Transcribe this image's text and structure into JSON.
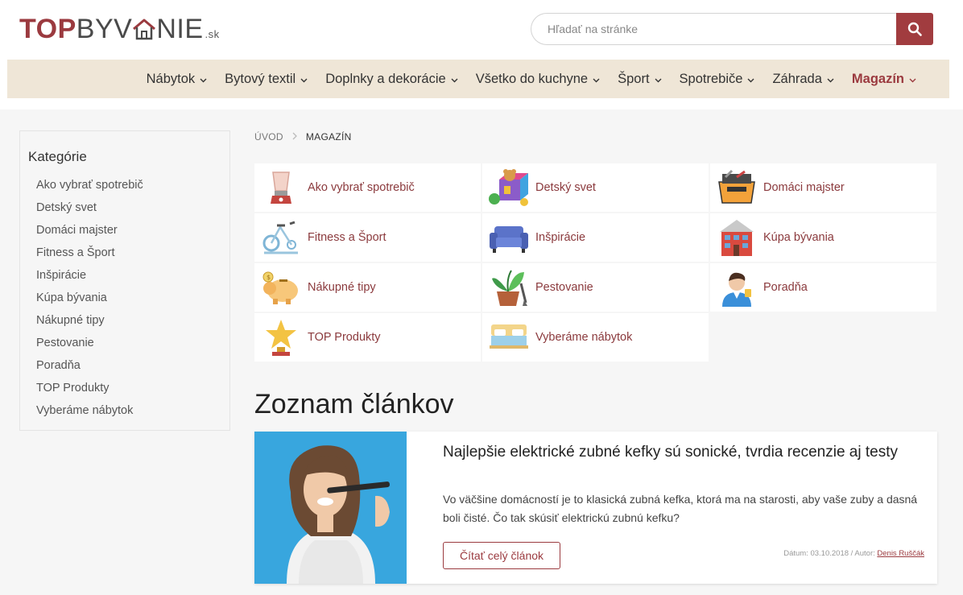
{
  "logo": {
    "part1": "TOP",
    "part2": "BYV",
    "part3": "NIE",
    "suffix": ".sk"
  },
  "search": {
    "placeholder": "Hľadať na stránke"
  },
  "nav": [
    {
      "label": "Nábytok",
      "active": false
    },
    {
      "label": "Bytový textil",
      "active": false
    },
    {
      "label": "Doplnky a dekorácie",
      "active": false
    },
    {
      "label": "Všetko do kuchyne",
      "active": false
    },
    {
      "label": "Šport",
      "active": false
    },
    {
      "label": "Spotrebiče",
      "active": false
    },
    {
      "label": "Záhrada",
      "active": false
    },
    {
      "label": "Magazín",
      "active": true
    }
  ],
  "sidebar": {
    "title": "Kategórie",
    "items": [
      "Ako vybrať spotrebič",
      "Detský svet",
      "Domáci majster",
      "Fitness a Šport",
      "Inšpirácie",
      "Kúpa bývania",
      "Nákupné tipy",
      "Pestovanie",
      "Poradňa",
      "TOP Produkty",
      "Vyberáme nábytok"
    ]
  },
  "breadcrumb": {
    "home": "ÚVOD",
    "current": "MAGAZÍN"
  },
  "categories": [
    {
      "label": "Ako vybrať spotrebič",
      "icon": "blender-icon"
    },
    {
      "label": "Detský svet",
      "icon": "toys-icon"
    },
    {
      "label": "Domáci majster",
      "icon": "toolbox-icon"
    },
    {
      "label": "Fitness a Šport",
      "icon": "exercise-bike-icon"
    },
    {
      "label": "Inšpirácie",
      "icon": "sofa-icon"
    },
    {
      "label": "Kúpa bývania",
      "icon": "building-icon"
    },
    {
      "label": "Nákupné tipy",
      "icon": "piggy-bank-icon"
    },
    {
      "label": "Pestovanie",
      "icon": "plant-icon"
    },
    {
      "label": "Poradňa",
      "icon": "advisor-icon"
    },
    {
      "label": "TOP Produkty",
      "icon": "trophy-icon"
    },
    {
      "label": "Vyberáme nábytok",
      "icon": "bed-icon"
    }
  ],
  "articles_heading": "Zoznam článkov",
  "article": {
    "title": "Najlepšie elektrické zubné kefky sú sonické, tvrdia recenzie aj testy",
    "excerpt": "Vo väčšine domácností je to klasická zubná kefka, ktorá ma na starosti, aby vaše zuby a dasná boli čisté. Čo tak skúsiť elektrickú zubnú kefku?",
    "button": "Čítať celý článok",
    "meta_prefix": "Dátum: 03.10.2018 / Autor: ",
    "author": "Denis Ruščák"
  },
  "colors": {
    "brand": "#9b3a3f",
    "nav_bg": "#efe6d7",
    "page_bg": "#f6f6f6",
    "image_bg": "#38a6de"
  }
}
